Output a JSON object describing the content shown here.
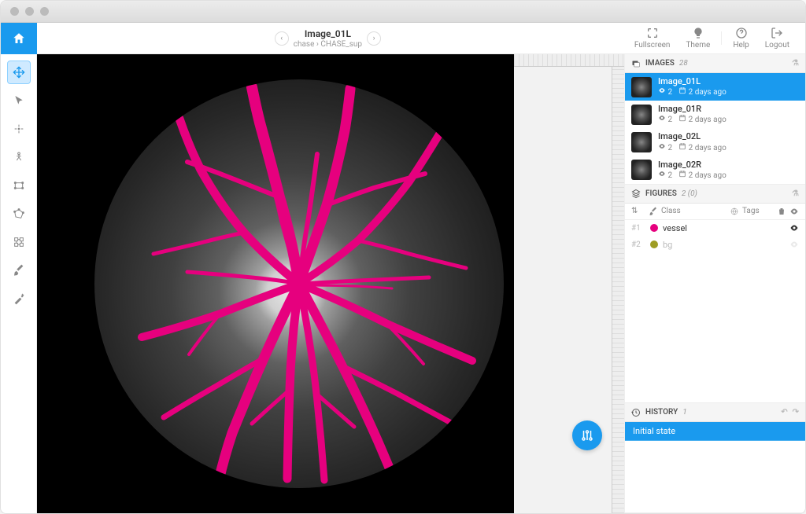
{
  "header": {
    "title": "Image_01L",
    "breadcrumb_project": "chase",
    "breadcrumb_dataset": "CHASE_sup",
    "actions": {
      "fullscreen": "Fullscreen",
      "theme": "Theme",
      "help": "Help",
      "logout": "Logout"
    }
  },
  "panels": {
    "images": {
      "title": "IMAGES",
      "count": "28",
      "items": [
        {
          "name": "Image_01L",
          "figures": "2",
          "date": "2 days ago",
          "selected": true
        },
        {
          "name": "Image_01R",
          "figures": "2",
          "date": "2 days ago",
          "selected": false
        },
        {
          "name": "Image_02L",
          "figures": "2",
          "date": "2 days ago",
          "selected": false
        },
        {
          "name": "Image_02R",
          "figures": "2",
          "date": "2 days ago",
          "selected": false
        }
      ]
    },
    "figures": {
      "title": "FIGURES",
      "count": "2",
      "sub": "(0)",
      "col_class": "Class",
      "col_tags": "Tags",
      "items": [
        {
          "idx": "#1",
          "color": "#e6007e",
          "name": "vessel",
          "visible": true
        },
        {
          "idx": "#2",
          "color": "#9e9d24",
          "name": "bg",
          "visible": false
        }
      ]
    },
    "history": {
      "title": "HISTORY",
      "count": "1",
      "items": [
        "Initial state"
      ]
    }
  },
  "colors": {
    "accent": "#1a9aee",
    "overlay": "#e6007e"
  }
}
